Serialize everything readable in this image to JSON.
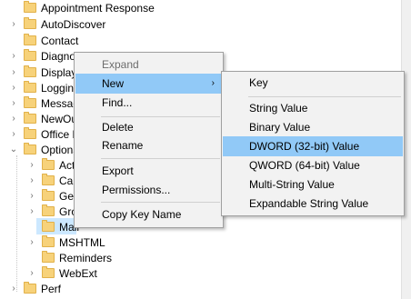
{
  "tree": {
    "items": [
      {
        "label": "Appointment Response"
      },
      {
        "label": "AutoDiscover"
      },
      {
        "label": "Contact"
      },
      {
        "label": "Diagnostics"
      },
      {
        "label": "Display"
      },
      {
        "label": "Logging"
      },
      {
        "label": "Messaging"
      },
      {
        "label": "NewOutlook"
      },
      {
        "label": "Office Explorer"
      },
      {
        "label": "Options"
      },
      {
        "label": "Actions"
      },
      {
        "label": "Calendar"
      },
      {
        "label": "General"
      },
      {
        "label": "Groups"
      },
      {
        "label": "Mail"
      },
      {
        "label": "MSHTML"
      },
      {
        "label": "Reminders"
      },
      {
        "label": "WebExt"
      },
      {
        "label": "Perf"
      }
    ]
  },
  "context_menu": {
    "expand": "Expand",
    "new": "New",
    "find": "Find...",
    "delete": "Delete",
    "rename": "Rename",
    "export": "Export",
    "permissions": "Permissions...",
    "copy_key_name": "Copy Key Name"
  },
  "new_submenu": {
    "key": "Key",
    "string_value": "String Value",
    "binary_value": "Binary Value",
    "dword_value": "DWORD (32-bit) Value",
    "qword_value": "QWORD (64-bit) Value",
    "multi_string_value": "Multi-String Value",
    "expandable_string_value": "Expandable String Value"
  },
  "icons": {
    "folder": "folder-icon",
    "collapsed": "chevron-right-icon",
    "expanded": "chevron-down-icon",
    "submenu": "submenu-arrow-icon"
  },
  "colors": {
    "menu_bg": "#f2f2f2",
    "highlight": "#91c9f7",
    "folder": "#f7d27a",
    "selection": "#cce8ff"
  }
}
